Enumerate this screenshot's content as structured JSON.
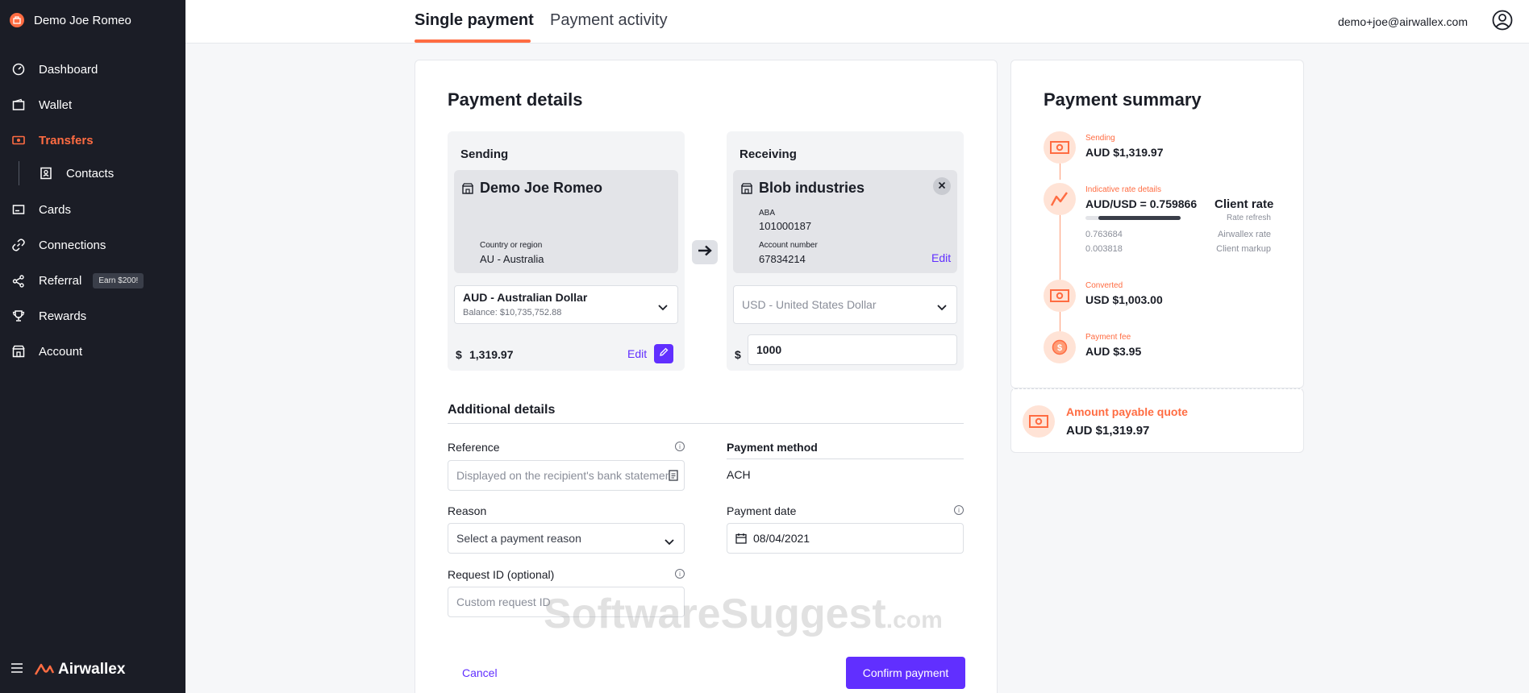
{
  "sidebar": {
    "org_name": "Demo Joe Romeo",
    "items": [
      {
        "label": "Dashboard",
        "icon": "dashboard-icon"
      },
      {
        "label": "Wallet",
        "icon": "wallet-icon"
      },
      {
        "label": "Transfers",
        "icon": "transfers-icon"
      },
      {
        "label": "Contacts",
        "icon": "contacts-icon"
      },
      {
        "label": "Cards",
        "icon": "card-icon"
      },
      {
        "label": "Connections",
        "icon": "link-icon"
      },
      {
        "label": "Referral",
        "icon": "share-icon"
      },
      {
        "label": "Rewards",
        "icon": "trophy-icon"
      },
      {
        "label": "Account",
        "icon": "building-icon"
      }
    ],
    "referral_badge": "Earn $200!",
    "brand": "Airwallex"
  },
  "header": {
    "tabs": [
      "Single payment",
      "Payment activity"
    ],
    "user_email": "demo+joe@airwallex.com"
  },
  "payment_details": {
    "title": "Payment details",
    "sending": {
      "title": "Sending",
      "name": "Demo Joe Romeo",
      "country_label": "Country or region",
      "country_value": "AU - Australia",
      "currency": "AUD - Australian Dollar",
      "balance": "Balance: $10,735,752.88",
      "currency_symbol": "$",
      "amount": "1,319.97",
      "edit_label": "Edit"
    },
    "receiving": {
      "title": "Receiving",
      "name": "Blob industries",
      "aba_label": "ABA",
      "aba_value": "101000187",
      "account_label": "Account number",
      "account_value": "67834214",
      "edit_label": "Edit",
      "currency_placeholder": "USD - United States Dollar",
      "currency_symbol": "$",
      "amount": "1000"
    }
  },
  "additional": {
    "title": "Additional details",
    "reference_label": "Reference",
    "reference_placeholder": "Displayed on the recipient's bank statement",
    "payment_method_label": "Payment method",
    "payment_method_value": "ACH",
    "reason_label": "Reason",
    "reason_placeholder": "Select a payment reason",
    "payment_date_label": "Payment date",
    "payment_date_value": "08/04/2021",
    "request_id_label": "Request ID (optional)",
    "request_id_placeholder": "Custom request ID"
  },
  "actions": {
    "cancel": "Cancel",
    "confirm": "Confirm payment"
  },
  "summary": {
    "title": "Payment summary",
    "sending_label": "Sending",
    "sending_value": "AUD $1,319.97",
    "rate_label": "Indicative rate details",
    "rate_value": "AUD/USD = 0.759866",
    "client_rate_label": "Client rate",
    "rate_refresh": "Rate refresh",
    "airwallex_rate_value": "0.763684",
    "airwallex_rate_label": "Airwallex rate",
    "client_markup_value": "0.003818",
    "client_markup_label": "Client markup",
    "converted_label": "Converted",
    "converted_value": "USD $1,003.00",
    "fee_label": "Payment fee",
    "fee_value": "AUD $3.95",
    "quote_label": "Amount payable quote",
    "quote_value": "AUD $1,319.97"
  },
  "watermark": {
    "main": "SoftwareSuggest",
    "suffix": ".com"
  },
  "colors": {
    "accent": "#ff6c42",
    "primary": "#612fff",
    "sidebar": "#1b1d26"
  }
}
